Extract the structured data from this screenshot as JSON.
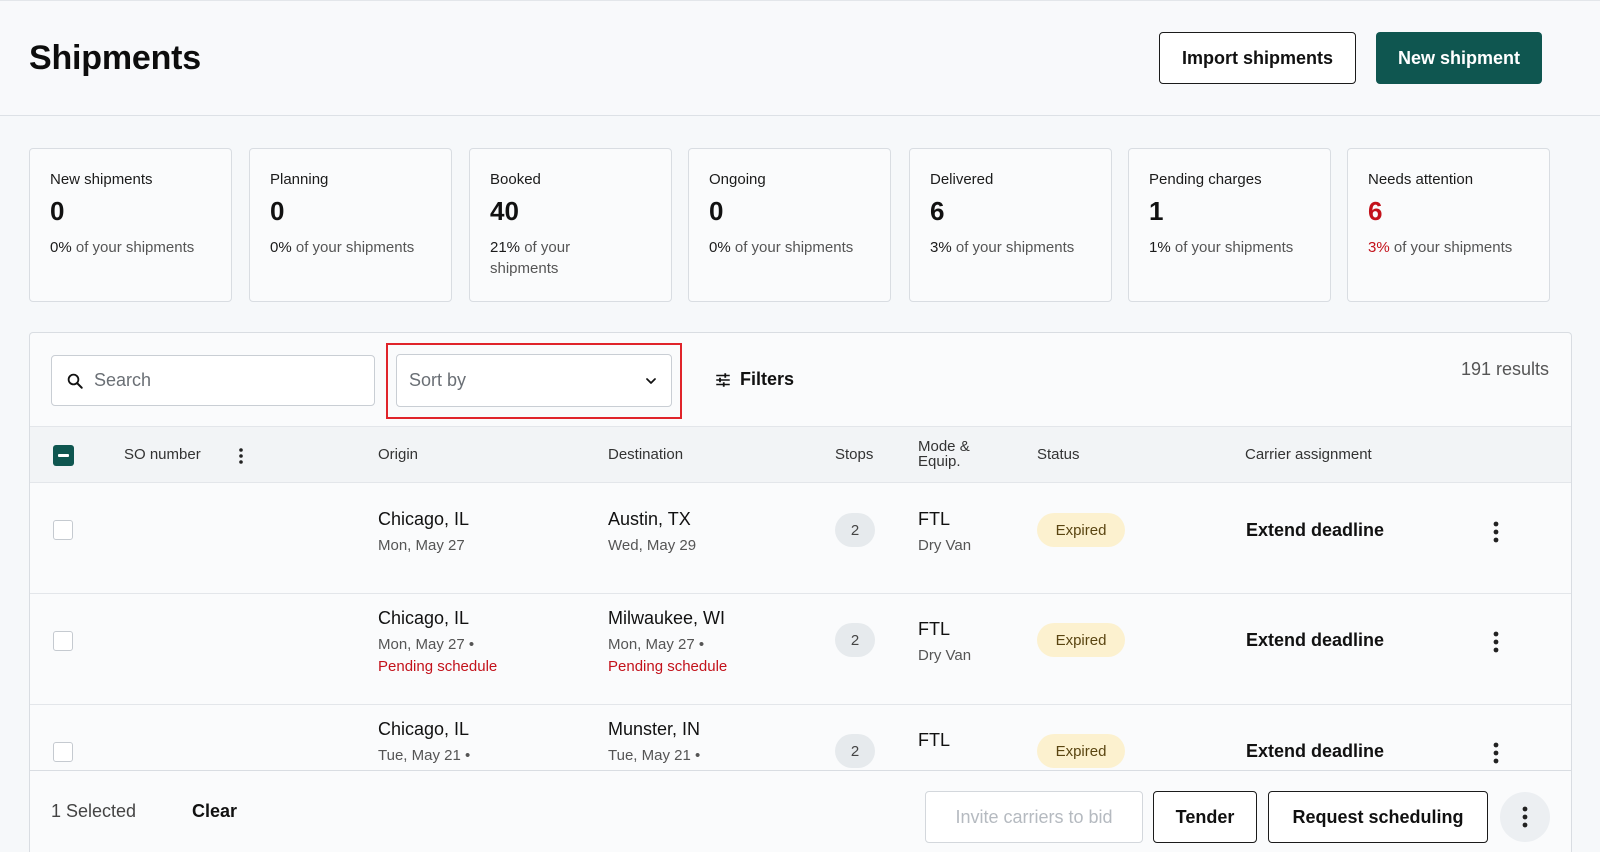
{
  "header": {
    "title": "Shipments",
    "import_label": "Import shipments",
    "new_label": "New shipment"
  },
  "summary_cards": [
    {
      "label": "New shipments",
      "value": "0",
      "pct": "0%",
      "sub": "of your shipments"
    },
    {
      "label": "Planning",
      "value": "0",
      "pct": "0%",
      "sub": "of your shipments"
    },
    {
      "label": "Booked",
      "value": "40",
      "pct": "21%",
      "sub": "of your shipments"
    },
    {
      "label": "Ongoing",
      "value": "0",
      "pct": "0%",
      "sub": "of your shipments"
    },
    {
      "label": "Delivered",
      "value": "6",
      "pct": "3%",
      "sub": "of your shipments"
    },
    {
      "label": "Pending charges",
      "value": "1",
      "pct": "1%",
      "sub": "of your shipments"
    },
    {
      "label": "Needs attention",
      "value": "6",
      "pct": "3%",
      "sub": "of your shipments"
    }
  ],
  "toolbar": {
    "search_placeholder": "Search",
    "sort_placeholder": "Sort by",
    "filters_label": "Filters",
    "results_text": "191 results"
  },
  "table": {
    "columns": {
      "so_number": "SO number",
      "origin": "Origin",
      "destination": "Destination",
      "stops": "Stops",
      "mode_line1": "Mode &",
      "mode_line2": "Equip.",
      "status": "Status",
      "carrier": "Carrier assignment"
    },
    "rows": [
      {
        "origin_city": "Chicago, IL",
        "origin_date": "Mon, May 27",
        "origin_pending": "",
        "dest_city": "Austin, TX",
        "dest_date": "Wed, May 29",
        "dest_pending": "",
        "stops": "2",
        "mode": "FTL",
        "equip": "Dry Van",
        "status": "Expired",
        "action": "Extend deadline"
      },
      {
        "origin_city": "Chicago, IL",
        "origin_date": "Mon, May 27 •",
        "origin_pending": "Pending schedule",
        "dest_city": "Milwaukee, WI",
        "dest_date": "Mon, May 27 •",
        "dest_pending": "Pending schedule",
        "stops": "2",
        "mode": "FTL",
        "equip": "Dry Van",
        "status": "Expired",
        "action": "Extend deadline"
      },
      {
        "origin_city": "Chicago, IL",
        "origin_date": "Tue, May 21 •",
        "origin_pending": "",
        "dest_city": "Munster, IN",
        "dest_date": "Tue, May 21 •",
        "dest_pending": "",
        "stops": "2",
        "mode": "FTL",
        "equip": "",
        "status": "Expired",
        "action": "Extend deadline"
      }
    ]
  },
  "footer": {
    "selected_text": "1 Selected",
    "clear_label": "Clear",
    "invite_label": "Invite carriers to bid",
    "tender_label": "Tender",
    "request_label": "Request scheduling"
  },
  "colors": {
    "primary": "#0f5650",
    "danger": "#c3121b",
    "expired_badge_bg": "#fcf1cf",
    "highlight": "#e0242a"
  },
  "icons": [
    "search-icon",
    "chevron-down-icon",
    "filters-icon",
    "more-vertical-icon"
  ]
}
